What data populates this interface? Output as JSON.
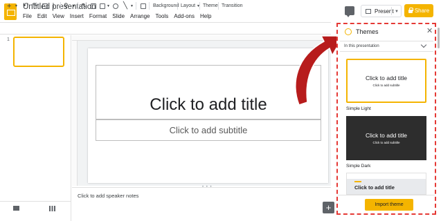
{
  "app": {
    "doc_title": "Untitled presentation",
    "menu": [
      "File",
      "Edit",
      "View",
      "Insert",
      "Format",
      "Slide",
      "Arrange",
      "Tools",
      "Add-ons",
      "Help"
    ],
    "present_label": "Present",
    "share_label": "Share"
  },
  "toolbar": {
    "background_label": "Background",
    "layout_label": "Layout",
    "theme_label": "Theme",
    "transition_label": "Transition"
  },
  "filmstrip": {
    "slide_number": "1"
  },
  "slide": {
    "title_placeholder": "Click to add title",
    "subtitle_placeholder": "Click to add subtitle"
  },
  "notes": {
    "placeholder": "Click to add speaker notes"
  },
  "themes_panel": {
    "title": "Themes",
    "source_label": "In this presentation",
    "themes": [
      {
        "name": "Simple Light",
        "title": "Click to add title",
        "subtitle": "Click to add subtitle"
      },
      {
        "name": "Simple Dark",
        "title": "Click to add title",
        "subtitle": "Click to add subtitle"
      },
      {
        "name": "",
        "title": "Click to add title",
        "subtitle": ""
      }
    ],
    "import_label": "Import theme"
  },
  "colors": {
    "accent": "#f4b400",
    "highlight": "#e53935",
    "arrow": "#b71c1c",
    "dark_theme": "#2d2d2d"
  }
}
